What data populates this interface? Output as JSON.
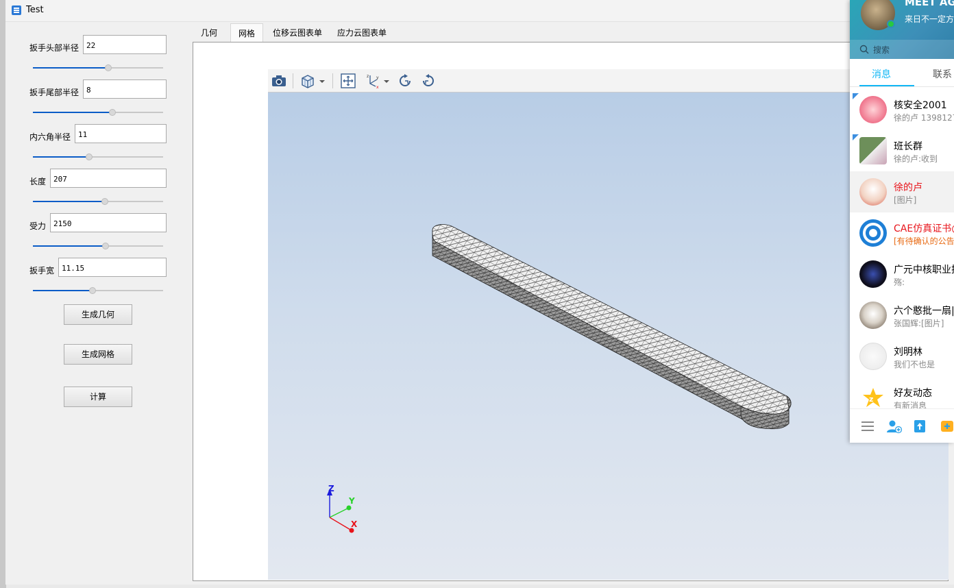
{
  "window": {
    "title": "Test"
  },
  "params": [
    {
      "label": "扳手头部半径",
      "value": "22",
      "slider_fraction": 0.58
    },
    {
      "label": "扳手尾部半径",
      "value": "8",
      "slider_fraction": 0.61
    },
    {
      "label": "内六角半径",
      "value": "11",
      "slider_fraction": 0.43
    },
    {
      "label": "长度",
      "value": "207",
      "slider_fraction": 0.55
    },
    {
      "label": "受力",
      "value": "2150",
      "slider_fraction": 0.56
    },
    {
      "label": "扳手宽",
      "value": "11.15",
      "slider_fraction": 0.46
    }
  ],
  "buttons": {
    "geometry": "生成几何",
    "mesh": "生成网格",
    "compute": "计算"
  },
  "tabs": [
    "几何",
    "网格",
    "位移云图表单",
    "应力云图表单"
  ],
  "active_tab": "网格",
  "viewer": {
    "toolbar_icons": [
      "camera-icon",
      "cube-view-icon",
      "fit-view-icon",
      "axes-orient-icon",
      "rotate-cw-icon",
      "rotate-ccw-icon"
    ],
    "axes": {
      "x": "X",
      "y": "Y",
      "z": "Z"
    },
    "axis_colors": {
      "x": "#e8131a",
      "y": "#28d12a",
      "z": "#1a1adc"
    },
    "background_top": "#b8cde6",
    "background_bottom": "#e3e8f0"
  },
  "qq": {
    "name": "MEET AG",
    "signature": "来日不一定方",
    "search_placeholder": "搜索",
    "tab_messages": "消息",
    "tab_contacts": "联系",
    "contacts": [
      {
        "name": "核安全2001",
        "msg": "徐的卢 1398127",
        "name_color": "#000000",
        "msg_color": "#888888"
      },
      {
        "name": "班长群",
        "msg": "徐的卢:收到",
        "name_color": "#000000",
        "msg_color": "#888888"
      },
      {
        "name": "徐的卢",
        "msg": "[图片]",
        "name_color": "#e8131a",
        "msg_color": "#888888"
      },
      {
        "name": "CAE仿真证书@",
        "msg": "[有待确认的公告",
        "name_color": "#e8131a",
        "msg_color": "#e86a13"
      },
      {
        "name": "广元中核职业技",
        "msg": "殇:",
        "name_color": "#000000",
        "msg_color": "#888888"
      },
      {
        "name": "六个憨批一扇|",
        "msg": "张国辉:[图片]",
        "name_color": "#000000",
        "msg_color": "#888888"
      },
      {
        "name": "刘明林",
        "msg": "我们不也是",
        "name_color": "#000000",
        "msg_color": "#888888"
      },
      {
        "name": "好友动态",
        "msg": "有新消息",
        "name_color": "#000000",
        "msg_color": "#888888"
      }
    ]
  }
}
